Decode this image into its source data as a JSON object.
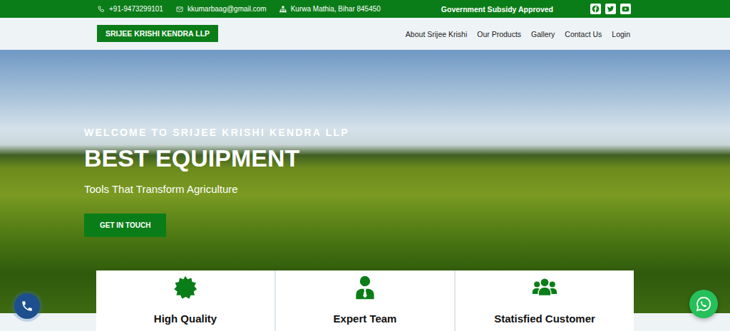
{
  "topbar": {
    "phone": "+91-9473299101",
    "email": "kkumarbaag@gmail.com",
    "address": "Kurwa Mathia, Bihar 845450",
    "notice": "Government Subsidy Approved"
  },
  "logo": "SRIJEE KRISHI KENDRA LLP",
  "nav": [
    "About Srijee Krishi",
    "Our Products",
    "Gallery",
    "Contact Us",
    "Login"
  ],
  "hero": {
    "eyebrow": "WELCOME TO SRIJEE KRISHI KENDRA LLP",
    "title": "BEST EQUIPMENT",
    "subtitle": "Tools That Transform Agriculture",
    "button": "GET IN TOUCH"
  },
  "features": [
    "High Quality",
    "Expert Team",
    "Statisfied Customer"
  ]
}
